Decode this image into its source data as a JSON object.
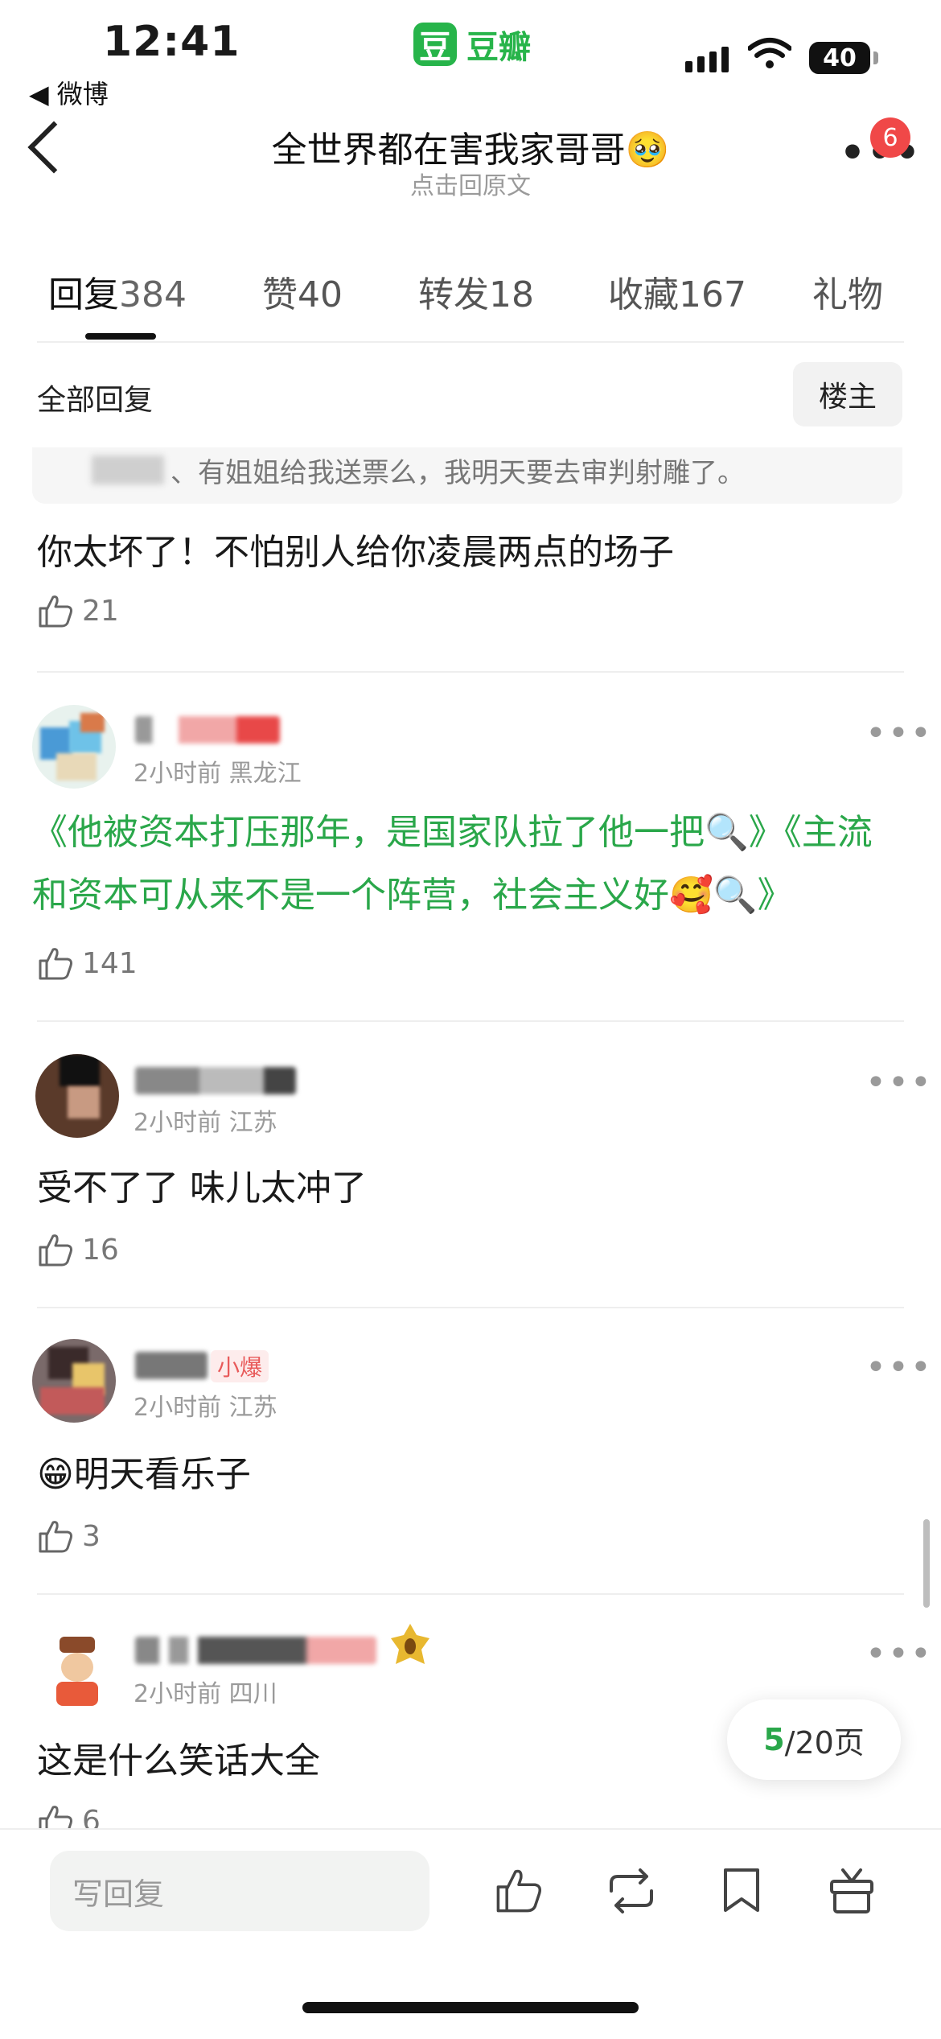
{
  "status_bar": {
    "time": "12:41",
    "back_app": "◀ 微博",
    "app_logo_char": "豆",
    "app_name": "豆瓣",
    "battery": "40"
  },
  "header": {
    "title": "全世界都在害我家哥哥🥹",
    "subtitle": "点击回原文",
    "notification_count": "6"
  },
  "tabs": [
    {
      "label": "回复",
      "count": "384",
      "active": true
    },
    {
      "label": "赞",
      "count": "40"
    },
    {
      "label": "转发",
      "count": "18"
    },
    {
      "label": "收藏",
      "count": "167"
    },
    {
      "label": "礼物",
      "count": ""
    }
  ],
  "filter": {
    "label": "全部回复",
    "op_button": "楼主"
  },
  "quoted_reply": "、有姐姐给我送票么，我明天要去审判射雕了。",
  "comments": [
    {
      "text": "你太坏了！不怕别人给你凌晨两点的场子",
      "likes": "21"
    },
    {
      "meta": "2小时前 黑龙江",
      "text_line1": "《他被资本打压那年，是国家队拉了他一把🔍》《主流",
      "text_line2": "和资本可从来不是一个阵营，社会主义好🥰🔍》",
      "likes": "141"
    },
    {
      "meta": "2小时前 江苏",
      "text": "受不了了 味儿太冲了",
      "likes": "16"
    },
    {
      "meta": "2小时前 江苏",
      "tag": "小爆",
      "text": "😁明天看乐子",
      "likes": "3"
    },
    {
      "meta": "2小时前 四川",
      "text": "这是什么笑话大全",
      "likes": "6"
    }
  ],
  "pager": {
    "current": "5",
    "total": "/20页"
  },
  "bottom_bar": {
    "reply_placeholder": "写回复"
  },
  "colors": {
    "accent": "#2aa74a",
    "badge": "#f04848",
    "brand": "#27b44a"
  }
}
